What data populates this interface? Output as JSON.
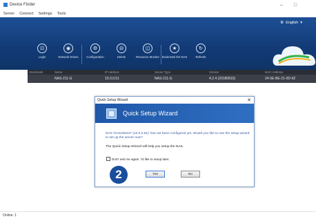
{
  "window": {
    "title": "Device Finder",
    "min": "–",
    "max": "□"
  },
  "menu": [
    "Server",
    "Connect",
    "Settings",
    "Tools"
  ],
  "language": {
    "icon": "gear-icon",
    "label": "English",
    "arrow": "▾"
  },
  "toolbar": [
    {
      "label": "Login",
      "icon": "login-icon",
      "glyph": "⊡"
    },
    {
      "label": "Network Drives",
      "icon": "network-drive-icon",
      "glyph": "◉"
    },
    {
      "label": "Configuration",
      "icon": "gear-icon",
      "glyph": "⚙"
    },
    {
      "label": "Delete",
      "icon": "delete-icon",
      "glyph": "⊟"
    },
    {
      "label": "Resource Monitor",
      "icon": "monitor-icon",
      "glyph": "◫"
    },
    {
      "label": "Bookmark the NAS",
      "icon": "star-icon",
      "glyph": "★"
    },
    {
      "label": "Refresh",
      "icon": "refresh-icon",
      "glyph": "↻"
    }
  ],
  "table": {
    "headers": [
      "Bookmark",
      "Name",
      "IP Address",
      "Server Type",
      "Version",
      "MAC Address"
    ],
    "rows": [
      [
        "",
        "NAS-211-G",
        "10.0.0.51",
        "NAS-211-G",
        "4.2.4 (20180810)",
        "24-5E-BE-21-0D-92"
      ]
    ]
  },
  "dialog": {
    "title": "Quick Setup Wizard",
    "close": "✕",
    "heading": "Quick Setup Wizard",
    "message": "NAS 'NAS226437 (10.0.0.51)' has not been configured yet. Would you like to use the setup wizard to set up the server now?",
    "info": "The Quick Setup Wizard will help you setup the NAS.",
    "checkbox_label": "Don't ask me again. I'd like to setup later.",
    "yes": "Yes",
    "no": "No"
  },
  "step_number": "2",
  "status": "Online: 1"
}
